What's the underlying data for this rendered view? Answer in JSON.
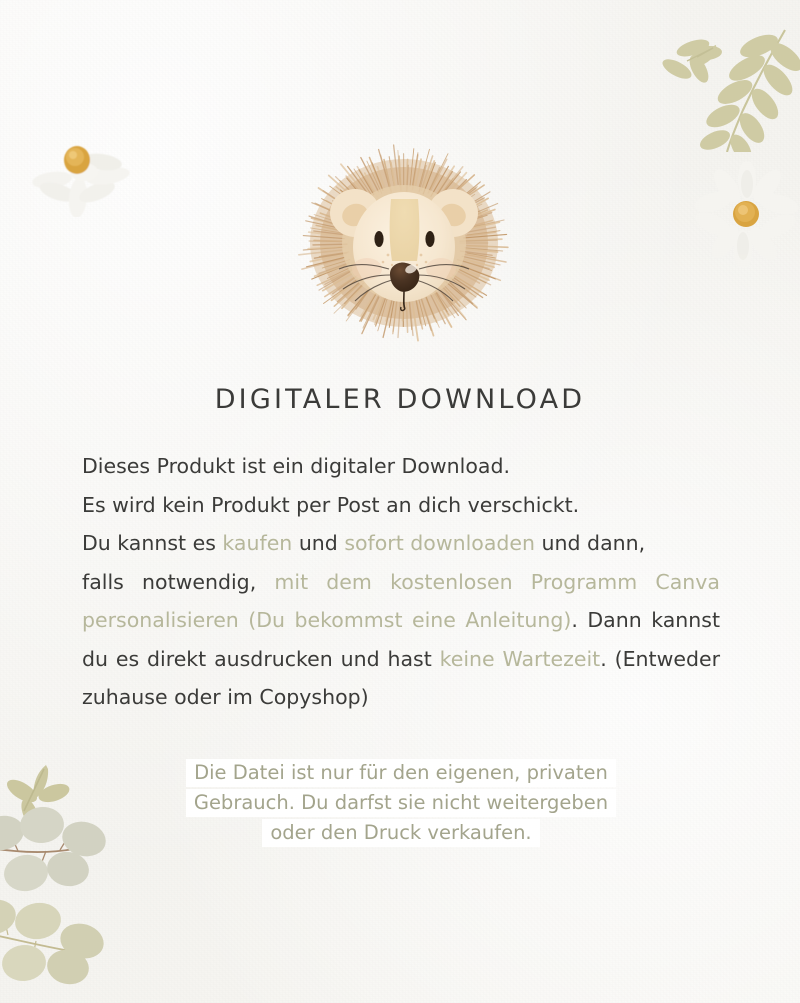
{
  "page": {
    "background_color": "#f8f7f4",
    "accent_sage": "#b6b79b",
    "text_dark": "#3b3b39",
    "daisy_center": "#d9a441",
    "mane_tan": "#d6b089",
    "leaf_olive": "#cfcba4"
  },
  "title": "DIGITALER DOWNLOAD",
  "body": {
    "line1": "Dieses Produkt ist ein digitaler Download.",
    "line2": "Es wird kein Produkt per Post an dich verschickt.",
    "line3_a": "Du kannst es ",
    "line3_sage1": "kaufen",
    "line3_b": " und ",
    "line3_sage2": "sofort downloaden",
    "line3_c": " und dann,",
    "para_a": "falls notwendig, ",
    "para_sage1": "mit dem kostenlosen Programm Canva personalisieren (Du bekommst eine Anleitung)",
    "para_b": ". Dann kannst du es direkt ausdrucken und hast ",
    "para_sage2": "keine Wartezeit",
    "para_c": ". (Entweder zuhause oder im Copyshop)"
  },
  "disclaimer": {
    "line1": "Die Datei ist nur für den eigenen, privaten",
    "line2": "Gebrauch. Du darfst sie nicht weitergeben",
    "line3": "oder den Druck verkaufen."
  },
  "decorations": {
    "lion": "lion-head-watercolor",
    "daisy_top_left": "daisy-flower",
    "daisy_right": "daisy-flower",
    "olive_branch_top_right": "olive-leaf-branch",
    "eucalyptus_bottom_left": "eucalyptus-branch"
  }
}
